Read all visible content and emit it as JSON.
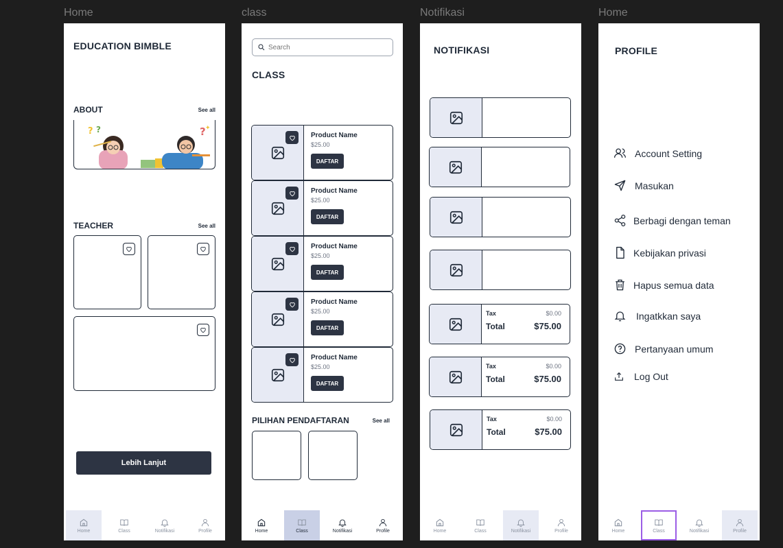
{
  "frames": {
    "home_label": "Home",
    "class_label": "class",
    "notif_label": "Notifikasi",
    "profile_label": "Home"
  },
  "nav": {
    "home": "Home",
    "class": "Class",
    "notif": "Notifikasi",
    "profile": "Profile"
  },
  "home": {
    "title": "EDUCATION BIMBLE",
    "about_title": "ABOUT",
    "about_see_all": "See all",
    "teacher_title": "TEACHER",
    "teacher_see_all": "See all",
    "more_button": "Lebih Lanjut"
  },
  "class": {
    "search_placeholder": "Search",
    "title": "CLASS",
    "products": [
      {
        "name": "Product Name",
        "price": "$25.00",
        "button": "DAFTAR"
      },
      {
        "name": "Product Name",
        "price": "$25.00",
        "button": "DAFTAR"
      },
      {
        "name": "Product Name",
        "price": "$25.00",
        "button": "DAFTAR"
      },
      {
        "name": "Product Name",
        "price": "$25.00",
        "button": "DAFTAR"
      },
      {
        "name": "Product Name",
        "price": "$25.00",
        "button": "DAFTAR"
      }
    ],
    "pilihan_title": "PILIHAN PENDAFTARAN",
    "pilihan_see_all": "See all"
  },
  "notif": {
    "title": "NOTIFIKASI",
    "receipts": [
      {
        "tax_label": "Tax",
        "tax_value": "$0.00",
        "total_label": "Total",
        "total_value": "$75.00"
      },
      {
        "tax_label": "Tax",
        "tax_value": "$0.00",
        "total_label": "Total",
        "total_value": "$75.00"
      },
      {
        "tax_label": "Tax",
        "tax_value": "$0.00",
        "total_label": "Total",
        "total_value": "$75.00"
      }
    ]
  },
  "profile": {
    "title": "PROFILE",
    "items": [
      {
        "label": "Account Setting",
        "icon": "users-icon"
      },
      {
        "label": "Masukan",
        "icon": "send-icon"
      },
      {
        "label": "Berbagi dengan teman",
        "icon": "share-icon"
      },
      {
        "label": "Kebijakan privasi",
        "icon": "file-icon"
      },
      {
        "label": "Hapus semua data",
        "icon": "trash-icon"
      },
      {
        "label": "Ingatkkan saya",
        "icon": "bell-icon"
      },
      {
        "label": "Pertanyaan umum",
        "icon": "help-circle-icon"
      },
      {
        "label": "Log Out",
        "icon": "upload-icon"
      }
    ]
  },
  "colors": {
    "background": "#1e1e1e",
    "dark_button": "#2d3443",
    "image_placeholder": "#e7eaf4",
    "nav_active_blue": "#c9d0e6",
    "selection_outline": "#9b5de5"
  }
}
